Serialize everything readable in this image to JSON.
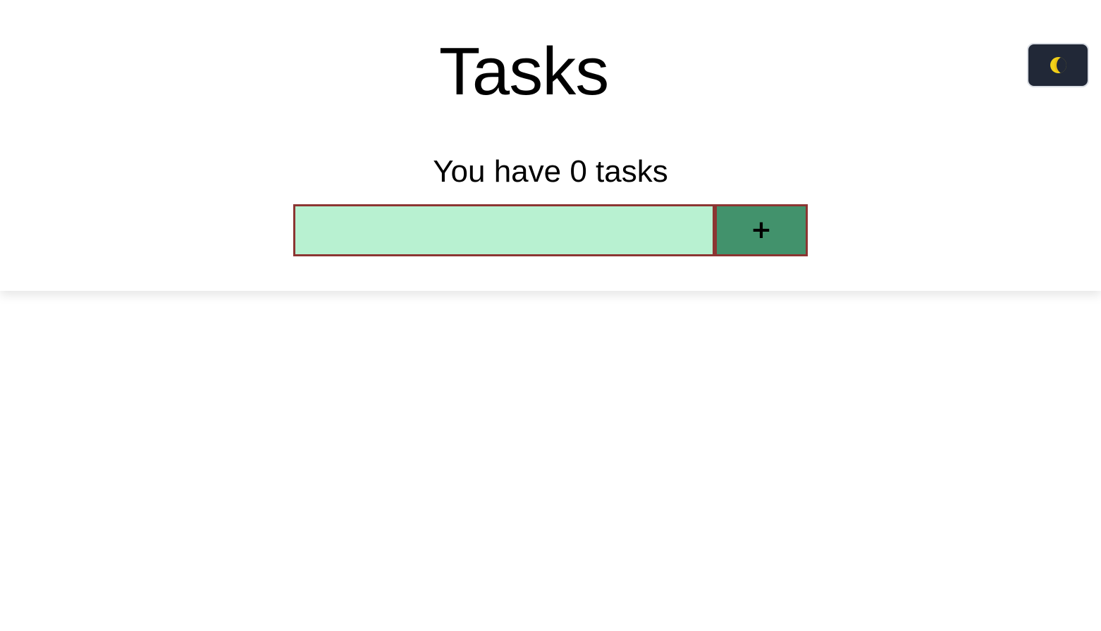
{
  "header": {
    "title": "Tasks",
    "task_count_text": "You have 0 tasks"
  },
  "theme_toggle": {
    "icon": "moon-icon"
  },
  "task_form": {
    "input_value": "",
    "input_placeholder": "",
    "add_label": "+"
  },
  "colors": {
    "input_background": "#b8f1d1",
    "button_background": "#42926c",
    "border": "#8c3532",
    "toggle_background": "#212837",
    "moon": "#f2d21a"
  }
}
